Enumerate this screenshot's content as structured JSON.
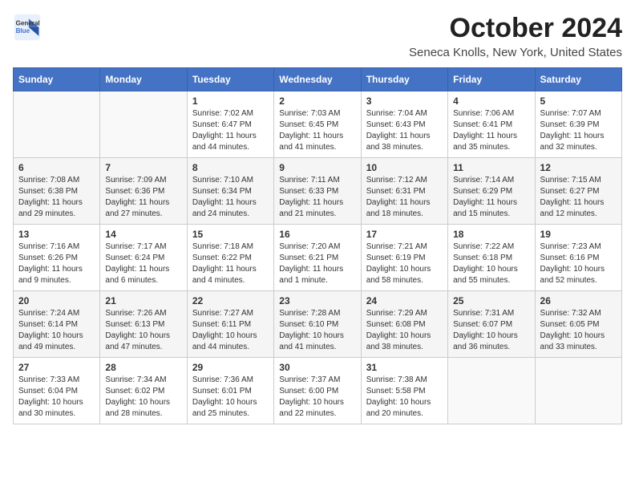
{
  "header": {
    "logo_line1": "General",
    "logo_line2": "Blue",
    "title": "October 2024",
    "subtitle": "Seneca Knolls, New York, United States"
  },
  "weekdays": [
    "Sunday",
    "Monday",
    "Tuesday",
    "Wednesday",
    "Thursday",
    "Friday",
    "Saturday"
  ],
  "weeks": [
    [
      {
        "day": "",
        "info": ""
      },
      {
        "day": "",
        "info": ""
      },
      {
        "day": "1",
        "info": "Sunrise: 7:02 AM\nSunset: 6:47 PM\nDaylight: 11 hours and 44 minutes."
      },
      {
        "day": "2",
        "info": "Sunrise: 7:03 AM\nSunset: 6:45 PM\nDaylight: 11 hours and 41 minutes."
      },
      {
        "day": "3",
        "info": "Sunrise: 7:04 AM\nSunset: 6:43 PM\nDaylight: 11 hours and 38 minutes."
      },
      {
        "day": "4",
        "info": "Sunrise: 7:06 AM\nSunset: 6:41 PM\nDaylight: 11 hours and 35 minutes."
      },
      {
        "day": "5",
        "info": "Sunrise: 7:07 AM\nSunset: 6:39 PM\nDaylight: 11 hours and 32 minutes."
      }
    ],
    [
      {
        "day": "6",
        "info": "Sunrise: 7:08 AM\nSunset: 6:38 PM\nDaylight: 11 hours and 29 minutes."
      },
      {
        "day": "7",
        "info": "Sunrise: 7:09 AM\nSunset: 6:36 PM\nDaylight: 11 hours and 27 minutes."
      },
      {
        "day": "8",
        "info": "Sunrise: 7:10 AM\nSunset: 6:34 PM\nDaylight: 11 hours and 24 minutes."
      },
      {
        "day": "9",
        "info": "Sunrise: 7:11 AM\nSunset: 6:33 PM\nDaylight: 11 hours and 21 minutes."
      },
      {
        "day": "10",
        "info": "Sunrise: 7:12 AM\nSunset: 6:31 PM\nDaylight: 11 hours and 18 minutes."
      },
      {
        "day": "11",
        "info": "Sunrise: 7:14 AM\nSunset: 6:29 PM\nDaylight: 11 hours and 15 minutes."
      },
      {
        "day": "12",
        "info": "Sunrise: 7:15 AM\nSunset: 6:27 PM\nDaylight: 11 hours and 12 minutes."
      }
    ],
    [
      {
        "day": "13",
        "info": "Sunrise: 7:16 AM\nSunset: 6:26 PM\nDaylight: 11 hours and 9 minutes."
      },
      {
        "day": "14",
        "info": "Sunrise: 7:17 AM\nSunset: 6:24 PM\nDaylight: 11 hours and 6 minutes."
      },
      {
        "day": "15",
        "info": "Sunrise: 7:18 AM\nSunset: 6:22 PM\nDaylight: 11 hours and 4 minutes."
      },
      {
        "day": "16",
        "info": "Sunrise: 7:20 AM\nSunset: 6:21 PM\nDaylight: 11 hours and 1 minute."
      },
      {
        "day": "17",
        "info": "Sunrise: 7:21 AM\nSunset: 6:19 PM\nDaylight: 10 hours and 58 minutes."
      },
      {
        "day": "18",
        "info": "Sunrise: 7:22 AM\nSunset: 6:18 PM\nDaylight: 10 hours and 55 minutes."
      },
      {
        "day": "19",
        "info": "Sunrise: 7:23 AM\nSunset: 6:16 PM\nDaylight: 10 hours and 52 minutes."
      }
    ],
    [
      {
        "day": "20",
        "info": "Sunrise: 7:24 AM\nSunset: 6:14 PM\nDaylight: 10 hours and 49 minutes."
      },
      {
        "day": "21",
        "info": "Sunrise: 7:26 AM\nSunset: 6:13 PM\nDaylight: 10 hours and 47 minutes."
      },
      {
        "day": "22",
        "info": "Sunrise: 7:27 AM\nSunset: 6:11 PM\nDaylight: 10 hours and 44 minutes."
      },
      {
        "day": "23",
        "info": "Sunrise: 7:28 AM\nSunset: 6:10 PM\nDaylight: 10 hours and 41 minutes."
      },
      {
        "day": "24",
        "info": "Sunrise: 7:29 AM\nSunset: 6:08 PM\nDaylight: 10 hours and 38 minutes."
      },
      {
        "day": "25",
        "info": "Sunrise: 7:31 AM\nSunset: 6:07 PM\nDaylight: 10 hours and 36 minutes."
      },
      {
        "day": "26",
        "info": "Sunrise: 7:32 AM\nSunset: 6:05 PM\nDaylight: 10 hours and 33 minutes."
      }
    ],
    [
      {
        "day": "27",
        "info": "Sunrise: 7:33 AM\nSunset: 6:04 PM\nDaylight: 10 hours and 30 minutes."
      },
      {
        "day": "28",
        "info": "Sunrise: 7:34 AM\nSunset: 6:02 PM\nDaylight: 10 hours and 28 minutes."
      },
      {
        "day": "29",
        "info": "Sunrise: 7:36 AM\nSunset: 6:01 PM\nDaylight: 10 hours and 25 minutes."
      },
      {
        "day": "30",
        "info": "Sunrise: 7:37 AM\nSunset: 6:00 PM\nDaylight: 10 hours and 22 minutes."
      },
      {
        "day": "31",
        "info": "Sunrise: 7:38 AM\nSunset: 5:58 PM\nDaylight: 10 hours and 20 minutes."
      },
      {
        "day": "",
        "info": ""
      },
      {
        "day": "",
        "info": ""
      }
    ]
  ]
}
